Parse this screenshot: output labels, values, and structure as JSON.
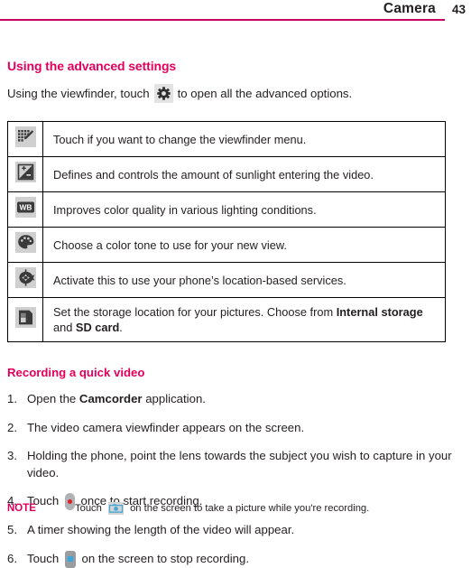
{
  "header": {
    "title": "Camera",
    "page_number": "43",
    "rule_color": "#c4005c"
  },
  "section": {
    "heading": "Using the advanced settings",
    "intro_before": "Using the viewfinder, touch",
    "intro_icon": "gear-icon",
    "intro_after": "to open all the advanced options."
  },
  "settings_table": {
    "rows": [
      {
        "icon": "grid-pencil-icon",
        "description": "Touch if you want to change the viewfinder menu."
      },
      {
        "icon": "exposure-icon",
        "description": "Defines and controls the amount of sunlight entering the video."
      },
      {
        "icon": "white-balance-icon",
        "icon_label": "WB",
        "description": "Improves color quality in various lighting conditions."
      },
      {
        "icon": "color-palette-icon",
        "description": "Choose a color tone to use for your new view."
      },
      {
        "icon": "geotag-location-icon",
        "description": "Activate this to use your phone’s location-based services."
      },
      {
        "icon": "sd-card-storage-icon",
        "description_part1": "Set the storage location for your pictures. Choose from ",
        "description_bold1": "Internal storage",
        "description_part2": " and ",
        "description_bold2": "SD card",
        "description_part3": "."
      }
    ]
  },
  "recording": {
    "heading": "Recording a quick video",
    "steps": [
      {
        "number": "1.",
        "text_before": "Open the ",
        "bold": "Camcorder",
        "text_after": " application."
      },
      {
        "number": "2.",
        "text_before": "The video camera viewfinder appears on the screen."
      },
      {
        "number": "3.",
        "text_before": "Holding the phone, point the lens towards the subject you wish to capture in your video."
      },
      {
        "number": "4.",
        "text_before": "Touch ",
        "icon": "record-button-icon",
        "text_after": " once to start recording."
      },
      {
        "number": "5.",
        "text_before": "A timer showing the length of the video will appear."
      },
      {
        "number": "6.",
        "text_before": "Touch ",
        "icon": "stop-button-icon",
        "text_after": " on the screen to stop recording."
      }
    ]
  },
  "note": {
    "label": "NOTE",
    "text_before": "Touch ",
    "icon": "camera-shutter-icon",
    "text_after": " on the screen to take a picture while you're recording."
  },
  "colors": {
    "accent_pink": "#e4005a",
    "rule_magenta": "#c4005c",
    "body_text": "#231f20",
    "icon_chip_bg": "#d0d0d0",
    "record_red": "#e02020",
    "stop_blue": "#3ba6dd"
  }
}
